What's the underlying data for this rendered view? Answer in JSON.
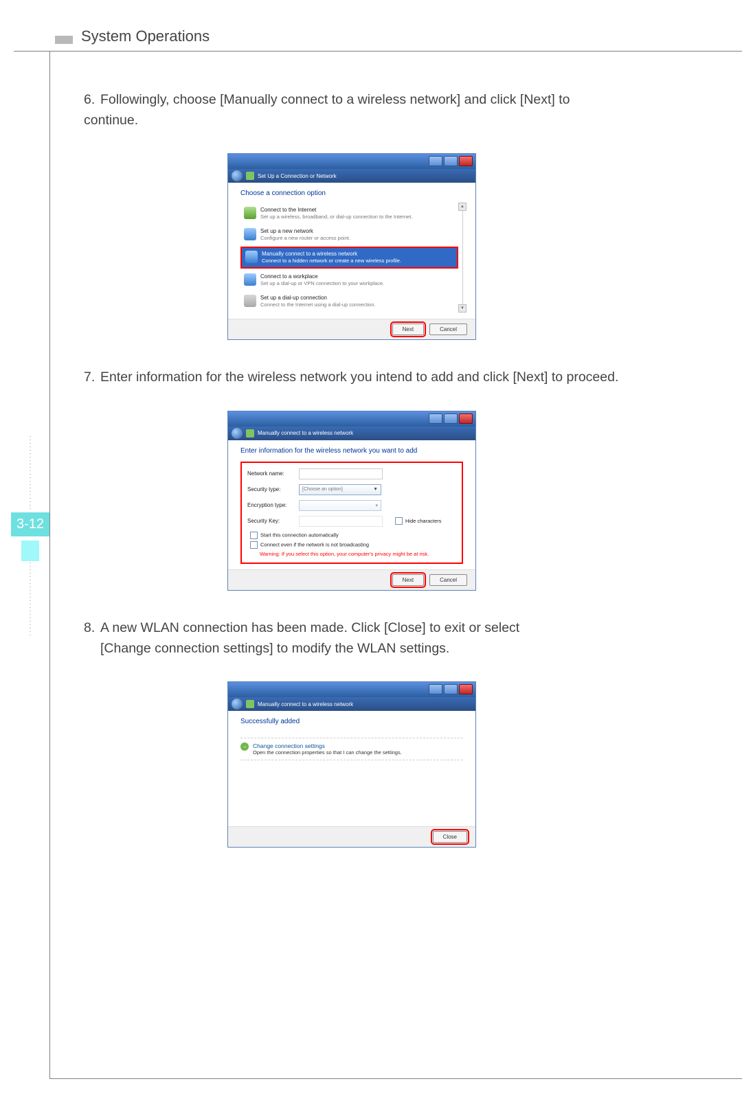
{
  "header": {
    "title": "System Operations"
  },
  "page_number": "3-12",
  "steps": {
    "s6_num": "6.",
    "s6_text": "Followingly, choose [Manually connect to a wireless network] and click [Next] to continue.",
    "s7_num": "7.",
    "s7_text": "Enter information for the wireless network you intend to add and click [Next] to proceed.",
    "s8_num": "8.",
    "s8_text_a": "A new WLAN connection has been made. Click [Close] to exit or select",
    "s8_text_b": "[Change connection settings] to modify the WLAN settings."
  },
  "win1": {
    "subbar": "Set Up a Connection or Network",
    "title": "Choose a connection option",
    "opts": [
      {
        "t": "Connect to the Internet",
        "s": "Set up a wireless, broadband, or dial-up connection to the Internet."
      },
      {
        "t": "Set up a new network",
        "s": "Configure a new router or access point."
      },
      {
        "t": "Manually connect to a wireless network",
        "s": "Connect to a hidden network or create a new wireless profile."
      },
      {
        "t": "Connect to a workplace",
        "s": "Set up a dial-up or VPN connection to your workplace."
      },
      {
        "t": "Set up a dial-up connection",
        "s": "Connect to the Internet using a dial-up connection."
      }
    ],
    "next": "Next",
    "cancel": "Cancel"
  },
  "win2": {
    "subbar": "Manually connect to a wireless network",
    "title": "Enter information for the wireless network you want to add",
    "labels": {
      "net": "Network name:",
      "sec": "Security type:",
      "enc": "Encryption type:",
      "key": "Security Key:",
      "hide": "Hide characters",
      "auto": "Start this connection automatically",
      "conn": "Connect even if the network is not broadcasting",
      "warn": "Warning: If you select this option, your computer's privacy might be at risk."
    },
    "sec_placeholder": "[Choose an option]",
    "next": "Next",
    "cancel": "Cancel"
  },
  "win3": {
    "subbar": "Manually connect to a wireless network",
    "title": "Successfully added",
    "cc_title": "Change connection settings",
    "cc_sub": "Open the connection properties so that I can change the settings.",
    "close": "Close"
  }
}
